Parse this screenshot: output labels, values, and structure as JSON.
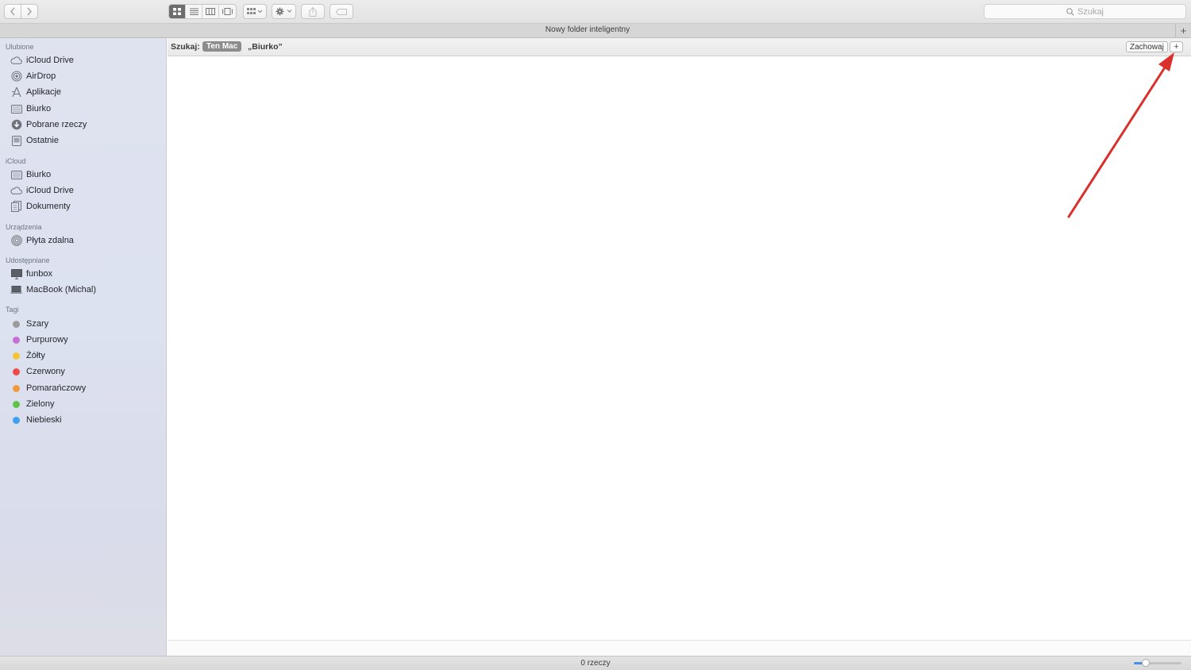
{
  "window": {
    "title": "Nowy folder inteligentny",
    "tab_add_label": "+",
    "search_placeholder": "Szukaj"
  },
  "toolbar": {
    "icons": [
      "back-icon",
      "forward-icon",
      "icon-view-icon",
      "list-view-icon",
      "column-view-icon",
      "gallery-view-icon",
      "group-icon",
      "gear-icon",
      "share-icon",
      "tag-icon"
    ],
    "active_view": "icon-view"
  },
  "sidebar": {
    "sections": [
      {
        "title": "Ulubione",
        "items": [
          {
            "label": "iCloud Drive",
            "icon": "cloud-icon"
          },
          {
            "label": "AirDrop",
            "icon": "airdrop-icon"
          },
          {
            "label": "Aplikacje",
            "icon": "applications-icon"
          },
          {
            "label": "Biurko",
            "icon": "desktop-icon"
          },
          {
            "label": "Pobrane rzeczy",
            "icon": "download-icon"
          },
          {
            "label": "Ostatnie",
            "icon": "recents-icon"
          }
        ]
      },
      {
        "title": "iCloud",
        "items": [
          {
            "label": "Biurko",
            "icon": "desktop-icon"
          },
          {
            "label": "iCloud Drive",
            "icon": "cloud-icon"
          },
          {
            "label": "Dokumenty",
            "icon": "documents-icon"
          }
        ]
      },
      {
        "title": "Urządzenia",
        "items": [
          {
            "label": "Płyta zdalna",
            "icon": "remote-disc-icon"
          }
        ]
      },
      {
        "title": "Udostępniane",
        "items": [
          {
            "label": "funbox",
            "icon": "display-icon"
          },
          {
            "label": "MacBook (Michal)",
            "icon": "laptop-icon"
          }
        ]
      },
      {
        "title": "Tagi",
        "items": [
          {
            "label": "Szary",
            "color": "#9b9b9b"
          },
          {
            "label": "Purpurowy",
            "color": "#c86fd6"
          },
          {
            "label": "Żółty",
            "color": "#f4c436"
          },
          {
            "label": "Czerwony",
            "color": "#ee4a4a"
          },
          {
            "label": "Pomarańczowy",
            "color": "#f39a3c"
          },
          {
            "label": "Zielony",
            "color": "#5fc249"
          },
          {
            "label": "Niebieski",
            "color": "#3fa0ee"
          }
        ]
      }
    ]
  },
  "search_bar": {
    "label": "Szukaj:",
    "scope_selected": "Ten Mac",
    "scope_other": "„Biurko”",
    "save_label": "Zachowaj",
    "add_label": "+"
  },
  "status": {
    "items_text": "0 rzeczy",
    "icon_size_level": 0.25
  },
  "annotation": {
    "color": "#d9302c"
  }
}
